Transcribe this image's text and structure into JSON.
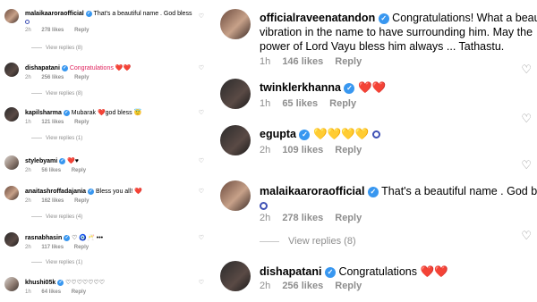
{
  "left": {
    "comments": [
      {
        "user": "malaikaaroraofficial",
        "text": "That's a beautiful name . God bless",
        "time": "2h",
        "likes": "278 likes",
        "reply": "Reply",
        "view_replies": "View replies (8)"
      },
      {
        "user": "dishapatani",
        "text": "Congratulations ❤️❤️",
        "time": "2h",
        "likes": "256 likes",
        "reply": "Reply",
        "view_replies": "View replies (8)"
      },
      {
        "user": "kapilsharma",
        "text": "Mubarak ❤️god bless 😇",
        "time": "1h",
        "likes": "121 likes",
        "reply": "Reply",
        "view_replies": "View replies (1)"
      },
      {
        "user": "stylebyami",
        "text": "❤️♥",
        "time": "2h",
        "likes": "56 likes",
        "reply": "Reply",
        "view_replies": ""
      },
      {
        "user": "anaitashroffadajania",
        "text": "Bless you all! ❤️",
        "time": "2h",
        "likes": "162 likes",
        "reply": "Reply",
        "view_replies": "View replies (4)"
      },
      {
        "user": "rasnabhasin",
        "text": "♡ 🧿🥂 •••",
        "time": "2h",
        "likes": "117 likes",
        "reply": "Reply",
        "view_replies": "View replies (1)"
      },
      {
        "user": "khushi05k",
        "text": "♡♡♡♡♡♡♡",
        "time": "1h",
        "likes": "64 likes",
        "reply": "Reply",
        "view_replies": ""
      }
    ]
  },
  "right": {
    "comments": [
      {
        "user": "officialraveenatandon",
        "text_lines": [
          "Congratulations! What a beautiful",
          "vibration in the name to have surrounding him. May the",
          "power of Lord Vayu bless him always ... Tathastu."
        ],
        "time": "1h",
        "likes": "146 likes",
        "reply": "Reply"
      },
      {
        "user": "twinklerkhanna",
        "text": "❤️❤️",
        "time": "1h",
        "likes": "65 likes",
        "reply": "Reply"
      },
      {
        "user": "egupta",
        "text": "💛💛💛💛",
        "time": "2h",
        "likes": "109 likes",
        "reply": "Reply"
      },
      {
        "user": "malaikaaroraofficial",
        "text": "That's a beautiful name . God bless",
        "time": "2h",
        "likes": "278 likes",
        "reply": "Reply",
        "view_replies": "View replies (8)"
      },
      {
        "user": "dishapatani",
        "text": "Congratulations ❤️❤️",
        "time": "2h",
        "likes": "256 likes",
        "reply": "Reply"
      }
    ]
  },
  "icons": {
    "verified": "verified-badge-icon",
    "heart": "heart-outline-icon"
  },
  "colors": {
    "verified": "#3897f0",
    "meta": "#8e8e8e",
    "heart": "#e0245e"
  }
}
